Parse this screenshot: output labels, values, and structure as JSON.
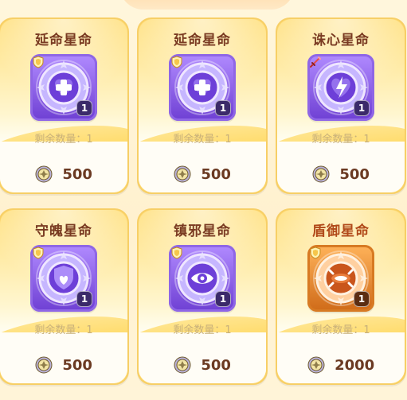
{
  "cards": [
    {
      "title": "延命星命",
      "remaining_label": "剩余数量：",
      "remaining_count": "1",
      "price": "500",
      "frame_color": "purple",
      "item_icon": "heart-cross-icon",
      "badge_icon": "shield-icon"
    },
    {
      "title": "延命星命",
      "remaining_label": "剩余数量：",
      "remaining_count": "1",
      "price": "500",
      "frame_color": "purple",
      "item_icon": "heart-cross-icon",
      "badge_icon": "shield-icon"
    },
    {
      "title": "诛心星命",
      "remaining_label": "剩余数量：",
      "remaining_count": "1",
      "price": "500",
      "frame_color": "purple",
      "item_icon": "lightning-heart-icon",
      "badge_icon": "sword-icon"
    },
    {
      "title": "守魄星命",
      "remaining_label": "剩余数量：",
      "remaining_count": "1",
      "price": "500",
      "frame_color": "purple",
      "item_icon": "shield-heart-icon",
      "badge_icon": "shield-icon"
    },
    {
      "title": "镇邪星命",
      "remaining_label": "剩余数量：",
      "remaining_count": "1",
      "price": "500",
      "frame_color": "purple",
      "item_icon": "eye-icon",
      "badge_icon": "shield-icon"
    },
    {
      "title": "盾御星命",
      "remaining_label": "剩余数量：",
      "remaining_count": "1",
      "price": "2000",
      "frame_color": "orange",
      "item_icon": "crab-icon",
      "badge_icon": "shield-icon"
    }
  ],
  "colors": {
    "card_bg_top": "#ffe07f",
    "title_text": "#7a3b22",
    "title_rare": "#b14a1a",
    "purple_frame": "#7a4ae0",
    "orange_frame": "#d77a23"
  }
}
